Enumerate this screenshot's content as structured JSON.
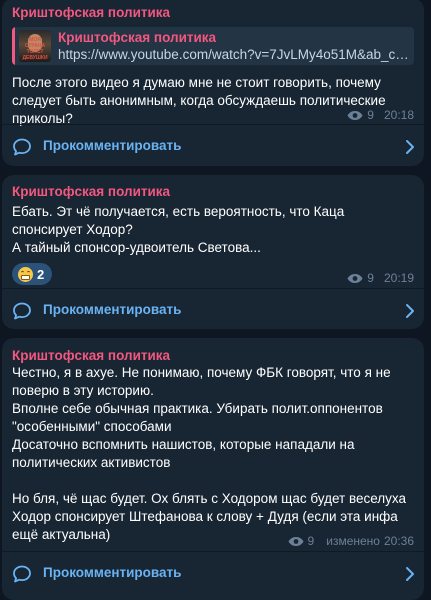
{
  "posts": [
    {
      "channel": "Криштофская политика",
      "link_preview": {
        "title": "Криштофская политика",
        "url": "https://www.youtube.com/watch?v=7JvLMy4o51M&ab_ch...",
        "thumb_caption": "МОЯ СТРАНА ТОЛСТ ДЕВУШКИ"
      },
      "text": "После этого видео я думаю мне не стоит говорить, почему следует быть анонимным, когда обсуждаешь политические приколы?",
      "views": "9",
      "time": "20:18",
      "comment_label": "Прокомментировать"
    },
    {
      "channel": "Криштофская политика",
      "text": "Ебать. Эт чё получается, есть вероятность, что Каца спонсирует Ходор?\nА тайный спонсор-удвоитель Светова...",
      "reaction": {
        "emoji": "grinning-face",
        "count": "2"
      },
      "views": "9",
      "time": "20:19",
      "comment_label": "Прокомментировать"
    },
    {
      "channel": "Криштофская политика",
      "text": "Честно, я в ахуе. Не понимаю, почему ФБК говорят, что я не поверю в эту историю.\nВполне себе обычная практика. Убирать полит.оппонентов \"особенными\" способами\nДосаточно вспомнить нашистов, которые нападали на политических активистов\n\nНо бля, чё щас будет. Ох блять с Ходором щас будет веселуха\nХодор спонсирует Штефанова к слову + Дудя (если эта инфа ещё актуальна)",
      "views": "9",
      "edited_label": "изменено",
      "time": "20:36",
      "comment_label": "Прокомментировать"
    }
  ],
  "colors": {
    "background": "#0e1621",
    "bubble": "#182533",
    "channel_name": "#f4577f",
    "accent": "#6ab3f3",
    "meta": "#6c8197"
  }
}
